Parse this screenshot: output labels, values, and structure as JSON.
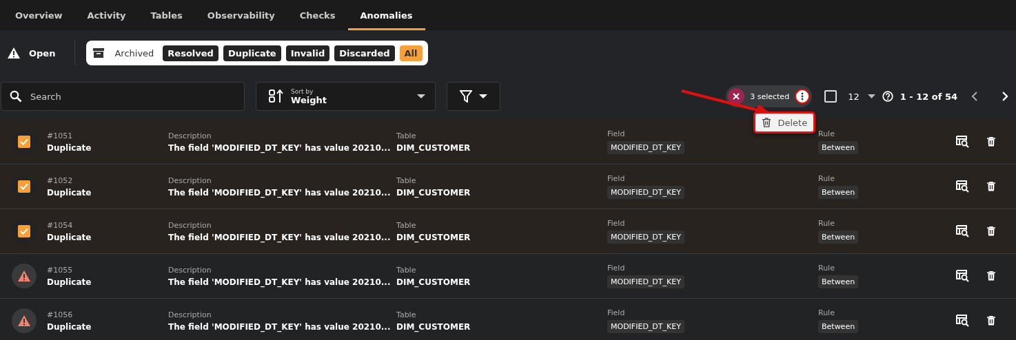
{
  "tabs": [
    {
      "label": "Overview",
      "selected": false
    },
    {
      "label": "Activity",
      "selected": false
    },
    {
      "label": "Tables",
      "selected": false
    },
    {
      "label": "Observability",
      "selected": false
    },
    {
      "label": "Checks",
      "selected": false
    },
    {
      "label": "Anomalies",
      "selected": true
    }
  ],
  "status_filter": {
    "open_label": "Open",
    "archived_label": "Archived",
    "options": [
      {
        "label": "Resolved",
        "selected": false
      },
      {
        "label": "Duplicate",
        "selected": false
      },
      {
        "label": "Invalid",
        "selected": false
      },
      {
        "label": "Discarded",
        "selected": false
      },
      {
        "label": "All",
        "selected": true
      }
    ]
  },
  "search": {
    "placeholder": "Search"
  },
  "sort": {
    "caption": "Sort by",
    "value": "Weight"
  },
  "selection": {
    "count_label": "3 selected",
    "menu": {
      "open": true,
      "items": [
        "Delete"
      ]
    }
  },
  "pagination": {
    "page_size": "12",
    "range": "1 - 12 of 54",
    "select_all": false
  },
  "rows": [
    {
      "selected": true,
      "id": "#1051",
      "type": "Duplicate",
      "description_label": "Description",
      "description": "The field 'MODIFIED_DT_KEY' has value 20210...",
      "table_label": "Table",
      "table": "DIM_CUSTOMER",
      "field_label": "Field",
      "field": "MODIFIED_DT_KEY",
      "rule_label": "Rule",
      "rule": "Between"
    },
    {
      "selected": true,
      "id": "#1052",
      "type": "Duplicate",
      "description_label": "Description",
      "description": "The field 'MODIFIED_DT_KEY' has value 20210...",
      "table_label": "Table",
      "table": "DIM_CUSTOMER",
      "field_label": "Field",
      "field": "MODIFIED_DT_KEY",
      "rule_label": "Rule",
      "rule": "Between"
    },
    {
      "selected": true,
      "id": "#1054",
      "type": "Duplicate",
      "description_label": "Description",
      "description": "The field 'MODIFIED_DT_KEY' has value 20210...",
      "table_label": "Table",
      "table": "DIM_CUSTOMER",
      "field_label": "Field",
      "field": "MODIFIED_DT_KEY",
      "rule_label": "Rule",
      "rule": "Between"
    },
    {
      "selected": false,
      "id": "#1055",
      "type": "Duplicate",
      "description_label": "Description",
      "description": "The field 'MODIFIED_DT_KEY' has value 20210...",
      "table_label": "Table",
      "table": "DIM_CUSTOMER",
      "field_label": "Field",
      "field": "MODIFIED_DT_KEY",
      "rule_label": "Rule",
      "rule": "Between"
    },
    {
      "selected": false,
      "id": "#1056",
      "type": "Duplicate",
      "description_label": "Description",
      "description": "The field 'MODIFIED_DT_KEY' has value 20210...",
      "table_label": "Table",
      "table": "DIM_CUSTOMER",
      "field_label": "Field",
      "field": "MODIFIED_DT_KEY",
      "rule_label": "Rule",
      "rule": "Between"
    }
  ]
}
